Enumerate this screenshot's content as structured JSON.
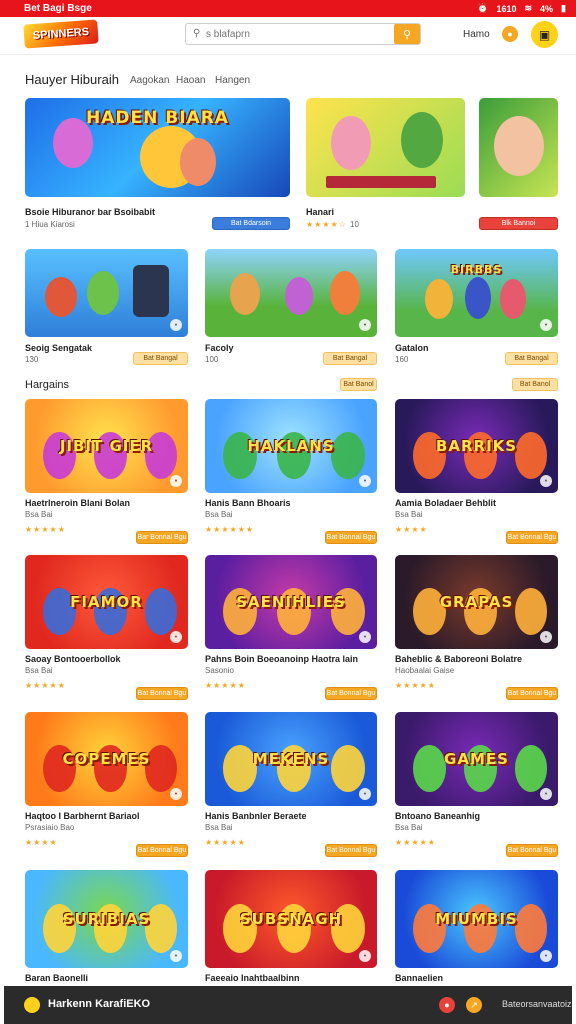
{
  "status_bar": {
    "left": "Bet Bagi Bsge",
    "time": "1610",
    "battery": "4%"
  },
  "header": {
    "logo_text": "SPINNERS",
    "search_placeholder": "s blafaprn",
    "link": "Hamo"
  },
  "category": {
    "title": "Hauyer Hiburaih",
    "tabs": [
      "Aagokan",
      "Haoan",
      "Hangen"
    ]
  },
  "featured": [
    {
      "title": "Bsoie Hiburanor bar Bsoibabit",
      "sub": "1 Hiua   Kiarosi",
      "chip": "Bat Bdarsoin",
      "art": "HADEN BIARA"
    },
    {
      "title": "Hanari",
      "stars": "★★★★☆",
      "sub": "10",
      "chip": ""
    },
    {
      "title": "",
      "sub": "",
      "chip": "Blk Bannoi"
    }
  ],
  "row2": [
    {
      "title": "Seoig Sengatak",
      "sub": "130",
      "chip": "Bat Bangal"
    },
    {
      "title": "Facoly",
      "sub": "100",
      "chip": "Bat Bangal"
    },
    {
      "title": "Gatalon",
      "sub": "160",
      "chip": "Bat Bangal",
      "art": "BIRBBS"
    }
  ],
  "section": {
    "label": "Hargains",
    "chips": [
      "Bat Banol",
      "Bat Banol"
    ]
  },
  "games": [
    {
      "title": "Haetrlneroin Blani Bolan",
      "sub": "Bsa Bai",
      "stars": "★★★★★",
      "chip": "Bar Bonnal Bgu",
      "art": "JIBIT GIER"
    },
    {
      "title": "Hanis Bann Bhoaris",
      "sub": "Bsa Bai",
      "stars": "★★★★★★",
      "chip": "Bat Bonnal Bgu",
      "art": "HAKLANS"
    },
    {
      "title": "Aamia Boladaer Behblit",
      "sub": "Bsa Bai",
      "stars": "★★★★",
      "chip": "Bat Bonnal Bgu",
      "art": "BARRIKS"
    },
    {
      "title": "Saoay Bontooerbollok",
      "sub": "Bsa Bai",
      "stars": "★★★★★",
      "chip": "Bat Bonnal Bgu",
      "art": "FIAMOR"
    },
    {
      "title": "Pahns Boin Boeoanoinp Haotra lain",
      "sub": "Sasonio",
      "stars": "★★★★★",
      "chip": "Bat Bonnal Bgu",
      "art": "SAENIHLIES"
    },
    {
      "title": "Baheblic & Baboreoni Bolatre",
      "sub": "Haobaalai Gaise",
      "stars": "★★★★★",
      "chip": "Bat Bonnal Bgu",
      "art": "GRAPAS"
    },
    {
      "title": "Haqtoo I Barbhernt Bariaol",
      "sub": "Psrasiaio Bao",
      "stars": "★★★★",
      "chip": "Bat Bonnal Bgu",
      "art": "COPEMES"
    },
    {
      "title": "Hanis Banbnler Beraete",
      "sub": "Bsa Bai",
      "stars": "★★★★★",
      "chip": "Bat Bonnal Bgu",
      "art": "MEKENS"
    },
    {
      "title": "Bntoano Baneanhig",
      "sub": "Bsa Bai",
      "stars": "★★★★★",
      "chip": "Bat Bonnal Bgu",
      "art": "GAMES"
    },
    {
      "title": "Baran Baonelli",
      "art": "SURIBIAS"
    },
    {
      "title": "Faeeaio Inahtbaalbinn",
      "art": "SUBSNAGH"
    },
    {
      "title": "Bannaelien",
      "art": "MIUMBIS"
    }
  ],
  "bottom_bar": {
    "title": "Harkenn KarafiEKO",
    "link": "Bateorsanvaatoiz"
  },
  "colors": {
    "brand_red": "#e8141b",
    "accent_orange": "#f5a623",
    "yellow": "#ffd21a"
  }
}
